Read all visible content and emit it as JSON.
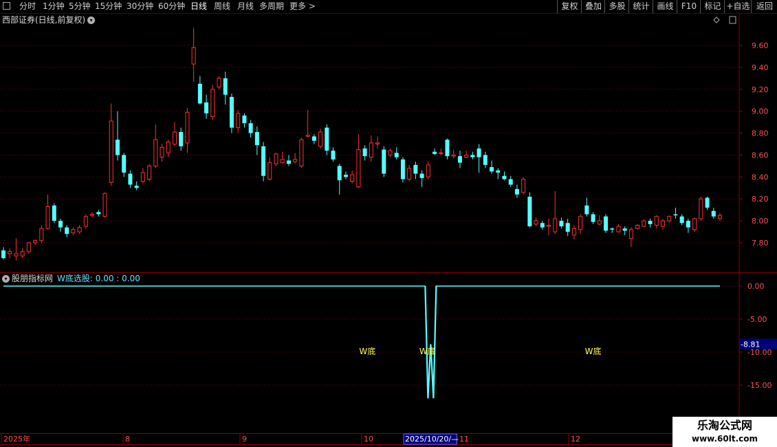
{
  "toolbar": {
    "left": [
      "分时",
      "1分钟",
      "5分钟",
      "15分钟",
      "30分钟",
      "60分钟",
      "日线",
      "周线",
      "月线",
      "多周期",
      "更多 >"
    ],
    "active_index": 6,
    "right": [
      "复权",
      "叠加",
      "多股",
      "统计",
      "画线",
      "F10",
      "标记",
      "+自选",
      "返回"
    ]
  },
  "main_title": "西部证券(日线,前复权)",
  "sub_title": {
    "name": "股朋指标网",
    "indicator": "W底选股: 0.00 : 0.00"
  },
  "price_axis": [
    "9.60",
    "9.40",
    "9.20",
    "9.00",
    "8.80",
    "8.60",
    "8.40",
    "8.20",
    "8.00",
    "7.80"
  ],
  "indicator_axis": [
    "0.00",
    "-5.00",
    "-10.00",
    "-15.00"
  ],
  "indicator_marker": "-8.81",
  "signal_label": "W底",
  "time_axis": [
    "2025年",
    "8",
    "9",
    "10",
    "11",
    "12"
  ],
  "time_cursor": "2025/10/20/—",
  "watermark": {
    "line1": "乐淘公式网",
    "line2": "www.60lt.com"
  },
  "colors": {
    "up": "#ff3232",
    "down": "#54ffff",
    "grid": "#8c0000",
    "axis_text": "#ff5050",
    "signal": "#ffff55"
  },
  "chart_data": {
    "type": "candlestick",
    "ylim": [
      7.65,
      9.8
    ],
    "candles": [
      [
        7.73,
        7.66,
        7.76,
        7.65
      ],
      [
        7.7,
        7.72,
        7.75,
        7.66
      ],
      [
        7.68,
        7.7,
        7.84,
        7.64
      ],
      [
        7.68,
        7.72,
        7.75,
        7.66
      ],
      [
        7.72,
        7.8,
        7.81,
        7.7
      ],
      [
        7.8,
        7.82,
        7.83,
        7.78
      ],
      [
        7.82,
        7.93,
        7.96,
        7.8
      ],
      [
        7.93,
        8.13,
        8.24,
        7.92
      ],
      [
        8.14,
        8.0,
        8.16,
        7.98
      ],
      [
        8.0,
        7.94,
        8.02,
        7.9
      ],
      [
        7.94,
        7.88,
        7.96,
        7.85
      ],
      [
        7.89,
        7.92,
        7.94,
        7.87
      ],
      [
        7.9,
        7.94,
        7.96,
        7.88
      ],
      [
        7.95,
        8.04,
        8.06,
        7.93
      ],
      [
        8.05,
        8.06,
        8.08,
        8.03
      ],
      [
        8.08,
        8.06,
        8.1,
        8.04
      ],
      [
        8.04,
        8.25,
        8.26,
        8.03
      ],
      [
        8.35,
        8.91,
        9.07,
        8.32
      ],
      [
        8.74,
        8.6,
        9.0,
        8.55
      ],
      [
        8.6,
        8.44,
        8.62,
        8.4
      ],
      [
        8.43,
        8.33,
        8.46,
        8.3
      ],
      [
        8.32,
        8.3,
        8.36,
        8.28
      ],
      [
        8.36,
        8.44,
        8.48,
        8.34
      ],
      [
        8.38,
        8.5,
        8.52,
        8.36
      ],
      [
        8.5,
        8.74,
        8.88,
        8.48
      ],
      [
        8.58,
        8.67,
        8.7,
        8.54
      ],
      [
        8.62,
        8.72,
        8.74,
        8.58
      ],
      [
        8.7,
        8.81,
        8.9,
        8.68
      ],
      [
        8.81,
        8.68,
        8.85,
        8.64
      ],
      [
        8.71,
        8.99,
        9.03,
        8.62
      ],
      [
        9.43,
        9.58,
        9.76,
        9.27
      ],
      [
        9.25,
        9.07,
        9.32,
        9.06
      ],
      [
        9.08,
        8.98,
        9.15,
        8.93
      ],
      [
        8.95,
        9.2,
        9.24,
        8.92
      ],
      [
        9.22,
        9.3,
        9.32,
        9.2
      ],
      [
        9.3,
        9.15,
        9.36,
        9.06
      ],
      [
        9.13,
        8.85,
        9.16,
        8.8
      ],
      [
        8.85,
        8.98,
        9.01,
        8.8
      ],
      [
        8.96,
        8.89,
        8.98,
        8.85
      ],
      [
        8.89,
        8.8,
        8.92,
        8.76
      ],
      [
        8.81,
        8.69,
        8.86,
        8.6
      ],
      [
        8.68,
        8.41,
        8.72,
        8.36
      ],
      [
        8.38,
        8.53,
        8.58,
        8.37
      ],
      [
        8.52,
        8.61,
        8.62,
        8.5
      ],
      [
        8.53,
        8.56,
        8.63,
        8.52
      ],
      [
        8.55,
        8.52,
        8.6,
        8.5
      ],
      [
        8.54,
        8.56,
        8.62,
        8.52
      ],
      [
        8.5,
        8.74,
        8.76,
        8.48
      ],
      [
        8.77,
        8.78,
        9.01,
        8.76
      ],
      [
        8.77,
        8.73,
        8.79,
        8.7
      ],
      [
        8.68,
        8.81,
        8.84,
        8.66
      ],
      [
        8.85,
        8.64,
        8.88,
        8.6
      ],
      [
        8.64,
        8.56,
        8.67,
        8.54
      ],
      [
        8.5,
        8.37,
        8.52,
        8.24
      ],
      [
        8.42,
        8.4,
        8.45,
        8.38
      ],
      [
        8.36,
        8.42,
        8.46,
        8.34
      ],
      [
        8.31,
        8.65,
        8.79,
        8.3
      ],
      [
        8.66,
        8.59,
        8.69,
        8.55
      ],
      [
        8.58,
        8.71,
        8.78,
        8.54
      ],
      [
        8.7,
        8.71,
        8.77,
        8.66
      ],
      [
        8.65,
        8.43,
        8.68,
        8.4
      ],
      [
        8.6,
        8.64,
        8.66,
        8.58
      ],
      [
        8.62,
        8.58,
        8.67,
        8.56
      ],
      [
        8.56,
        8.38,
        8.58,
        8.35
      ],
      [
        8.38,
        8.48,
        8.51,
        8.36
      ],
      [
        8.51,
        8.43,
        8.54,
        8.38
      ],
      [
        8.43,
        8.39,
        8.46,
        8.31
      ],
      [
        8.4,
        8.51,
        8.54,
        8.38
      ],
      [
        8.63,
        8.61,
        8.66,
        8.6
      ],
      [
        8.62,
        8.62,
        8.66,
        8.6
      ],
      [
        8.74,
        8.59,
        8.75,
        8.56
      ],
      [
        8.59,
        8.6,
        8.65,
        8.57
      ],
      [
        8.59,
        8.53,
        8.64,
        8.48
      ],
      [
        8.58,
        8.6,
        8.64,
        8.57
      ],
      [
        8.6,
        8.58,
        8.63,
        8.56
      ],
      [
        8.66,
        8.58,
        8.7,
        8.44
      ],
      [
        8.6,
        8.51,
        8.63,
        8.48
      ],
      [
        8.49,
        8.45,
        8.55,
        8.43
      ],
      [
        8.46,
        8.44,
        8.48,
        8.38
      ],
      [
        8.41,
        8.38,
        8.45,
        8.37
      ],
      [
        8.38,
        8.33,
        8.41,
        8.31
      ],
      [
        8.29,
        8.24,
        8.33,
        8.21
      ],
      [
        8.26,
        8.38,
        8.4,
        8.24
      ],
      [
        8.22,
        7.95,
        8.26,
        7.94
      ],
      [
        7.97,
        8.0,
        8.03,
        7.95
      ],
      [
        7.98,
        7.94,
        8.0,
        7.92
      ],
      [
        7.95,
        7.96,
        8.02,
        7.87
      ],
      [
        7.9,
        8.02,
        8.27,
        7.88
      ],
      [
        8.0,
        7.95,
        8.03,
        7.93
      ],
      [
        7.98,
        7.9,
        8.02,
        7.86
      ],
      [
        7.87,
        7.93,
        7.96,
        7.83
      ],
      [
        7.92,
        8.04,
        8.06,
        7.88
      ],
      [
        8.14,
        8.06,
        8.21,
        8.04
      ],
      [
        8.06,
        7.99,
        8.08,
        7.97
      ],
      [
        7.97,
        8.0,
        8.05,
        7.96
      ],
      [
        8.04,
        7.91,
        8.06,
        7.89
      ],
      [
        7.93,
        7.92,
        7.94,
        7.89
      ],
      [
        7.9,
        7.95,
        7.97,
        7.89
      ],
      [
        7.93,
        7.91,
        7.95,
        7.87
      ],
      [
        7.84,
        7.92,
        7.94,
        7.76
      ],
      [
        7.93,
        7.96,
        7.97,
        7.92
      ],
      [
        7.95,
        8.0,
        8.01,
        7.94
      ],
      [
        8.0,
        7.97,
        8.02,
        7.94
      ],
      [
        7.96,
        8.04,
        8.05,
        7.93
      ],
      [
        7.95,
        8.0,
        8.02,
        7.92
      ],
      [
        8.0,
        8.04,
        8.05,
        7.98
      ],
      [
        8.06,
        8.05,
        8.12,
        8.02
      ],
      [
        8.04,
        7.98,
        8.06,
        7.96
      ],
      [
        8.0,
        7.94,
        8.02,
        7.89
      ],
      [
        7.92,
        8.02,
        8.03,
        7.9
      ],
      [
        8.02,
        8.2,
        8.22,
        8.0
      ],
      [
        8.21,
        8.12,
        8.22,
        8.1
      ],
      [
        8.09,
        8.04,
        8.12,
        8.02
      ],
      [
        8.02,
        8.05,
        8.07,
        8.0
      ]
    ],
    "indicator": {
      "name": "W底选股",
      "ylim": [
        -17.3,
        0.2
      ],
      "values_first_part": 0.0,
      "dip_values": [
        -17.0,
        -8.81,
        -17.0
      ],
      "signal_positions": [
        0.508,
        0.592,
        0.823
      ]
    }
  }
}
